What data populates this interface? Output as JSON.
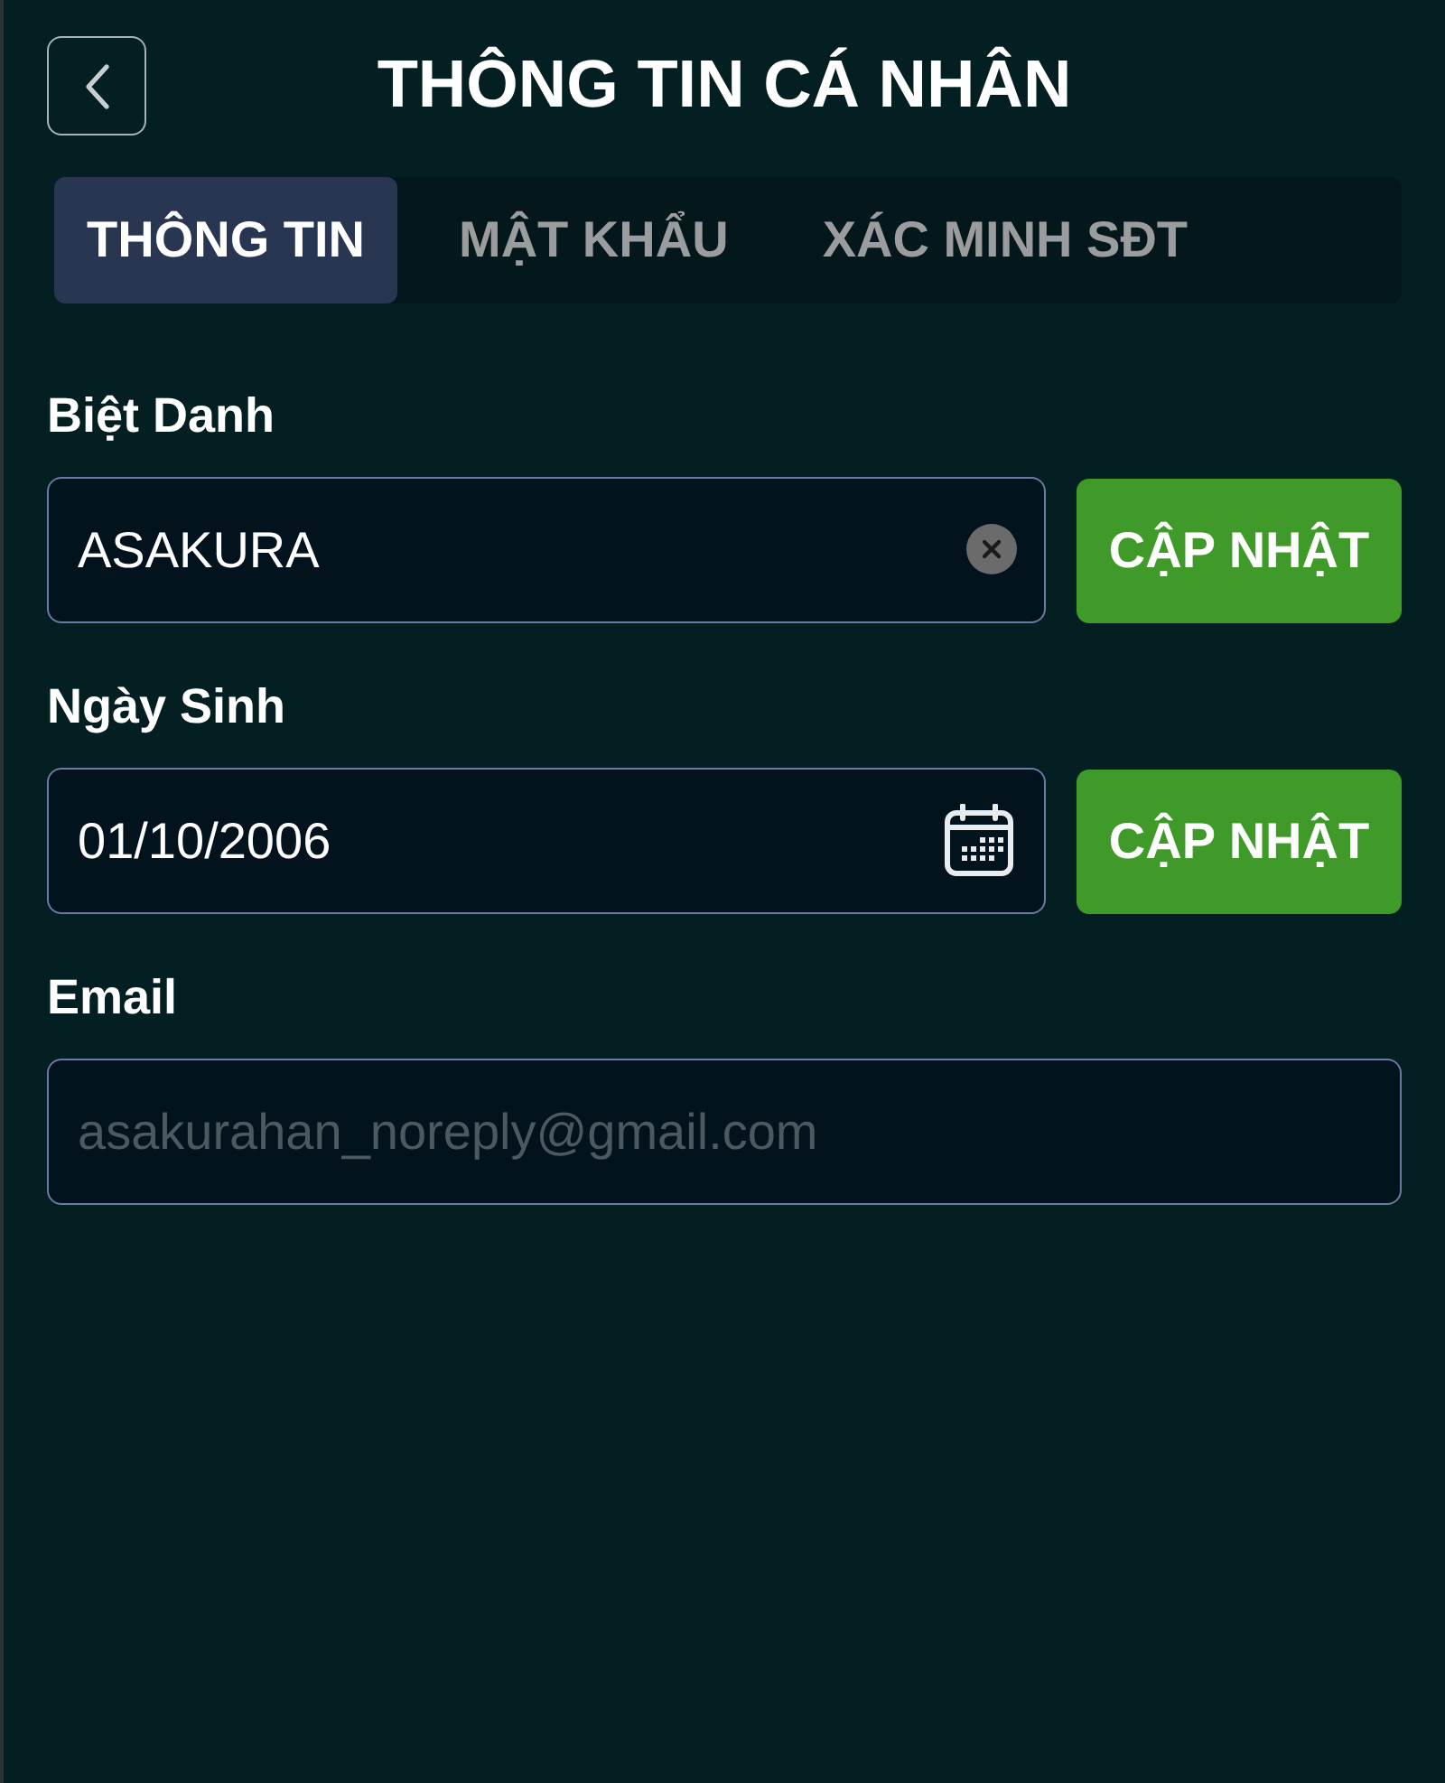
{
  "header": {
    "title": "THÔNG TIN CÁ NHÂN"
  },
  "tabs": [
    {
      "label": "THÔNG TIN",
      "selected": true
    },
    {
      "label": "MẬT KHẨU",
      "selected": false
    },
    {
      "label": "XÁC MINH SĐT",
      "selected": false
    }
  ],
  "fields": [
    {
      "kind": "text",
      "label": "Biệt Danh",
      "value": "ASAKURA",
      "disabled": false,
      "button": "CẬP NHẬT"
    },
    {
      "kind": "date",
      "label": "Ngày Sinh",
      "value": "01/10/2006",
      "disabled": false,
      "button": "CẬP NHẬT"
    },
    {
      "kind": "email",
      "label": "Email",
      "value": "asakurahan_noreply@gmail.com",
      "disabled": true
    }
  ]
}
